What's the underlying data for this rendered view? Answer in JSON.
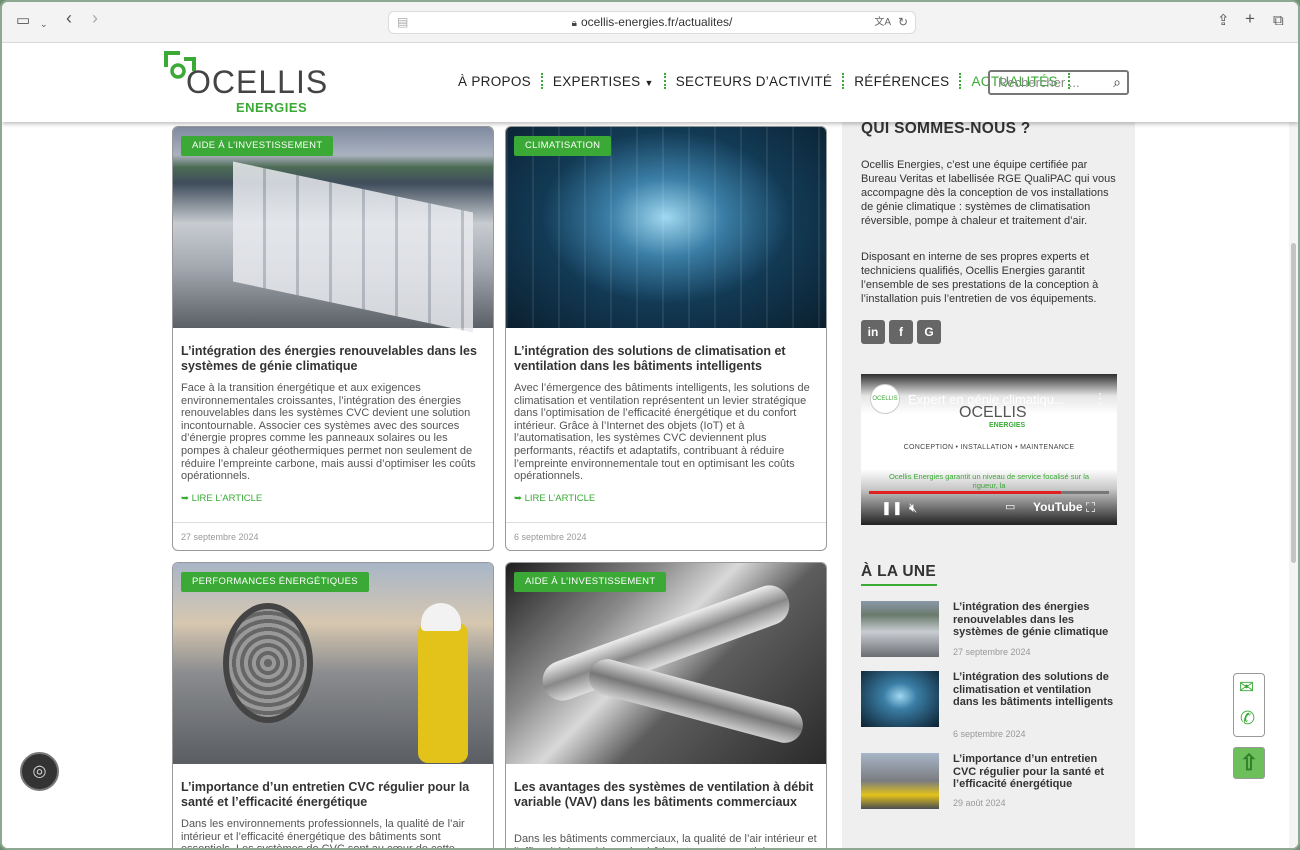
{
  "browser": {
    "url": "ocellis-energies.fr/actualites/"
  },
  "logo": {
    "word": "OCELLIS",
    "sub": "ENERGIES"
  },
  "nav": {
    "items": [
      "À PROPOS",
      "EXPERTISES",
      "SECTEURS D’ACTIVITÉ",
      "RÉFÉRENCES",
      "ACTUALITÉS"
    ],
    "active": "ACTUALITÉS",
    "search_placeholder": "Rechercher ..."
  },
  "articles": [
    {
      "badge": "AIDE À L’INVESTISSEMENT",
      "title": "L’intégration des énergies renouvelables dans les systèmes de génie climatique",
      "desc": "Face à la transition énergétique et aux exigences environnementales croissantes, l’intégration des énergies renouvelables dans les systèmes CVC devient une solution incontournable. Associer ces systèmes avec des sources d’énergie propres comme les panneaux solaires ou les pompes à chaleur géothermiques permet non seulement de réduire l’empreinte carbone, mais aussi d’optimiser les coûts opérationnels.",
      "more": "LIRE L’ARTICLE",
      "date": "27 septembre 2024"
    },
    {
      "badge": "CLIMATISATION",
      "title": "L’intégration des solutions de climatisation et ventilation dans les bâtiments intelligents",
      "desc": "Avec l’émergence des bâtiments intelligents, les solutions de climatisation et ventilation représentent un levier stratégique dans l’optimisation de l’efficacité énergétique et du confort intérieur. Grâce à l’Internet des objets (IoT) et à l’automatisation, les systèmes CVC deviennent plus performants, réactifs et adaptatifs, contribuant à réduire l’empreinte environnementale tout en optimisant les coûts opérationnels.",
      "more": "LIRE L’ARTICLE",
      "date": "6 septembre 2024"
    },
    {
      "badge": "PERFORMANCES ÉNERGÉTIQUES",
      "title": "L’importance d’un entretien CVC régulier pour la santé et l’efficacité énergétique",
      "desc": "Dans les environnements professionnels, la qualité de l’air intérieur et l’efficacité énergétique des bâtiments sont essentiels. Les systèmes de CVC sont au cœur de cette"
    },
    {
      "badge": "AIDE À L’INVESTISSEMENT",
      "title": "Les avantages des systèmes de ventilation à débit variable (VAV) dans les bâtiments commerciaux",
      "desc": "Dans les bâtiments commerciaux, la qualité de l’air intérieur et l’efficacité énergétique des bâtiments sont essentiels."
    }
  ],
  "sidebar": {
    "about_title": "QUI SOMMES-NOUS ?",
    "about_p1": "Ocellis Energies, c’est une équipe certifiée par Bureau Veritas et labellisée RGE QualiPAC qui vous accompagne dès la conception de vos installations de génie climatique : systèmes de climatisation réversible, pompe à chaleur et traitement d’air.",
    "about_p2": "Disposant en interne de ses propres experts et techniciens qualifiés, Ocellis Energies garantit l’ensemble de ses prestations de la conception à l’installation puis l’entretien de vos équipements.",
    "social": [
      "in",
      "f",
      "G"
    ],
    "video": {
      "title": "Expert en génie climatiqu...",
      "brand": "OCELLIS",
      "brand_sub": "ENERGIES",
      "tagline": "CONCEPTION • INSTALLATION • MAINTENANCE",
      "caption": "Ocellis Energies garantit un niveau de service focalisé sur la rigueur, la",
      "platform": "YouTube",
      "progress": 0.8
    },
    "une_title": "À LA UNE",
    "une": [
      {
        "title": "L’intégration des énergies renouvelables dans les systèmes de génie climatique",
        "date": "27 septembre 2024"
      },
      {
        "title": "L’intégration des solutions de climatisation et ventilation dans les bâtiments intelligents",
        "date": "6 septembre 2024"
      },
      {
        "title": "L’importance d’un entretien CVC régulier pour la santé et l’efficacité énergétique",
        "date": "29 août 2024"
      }
    ]
  }
}
